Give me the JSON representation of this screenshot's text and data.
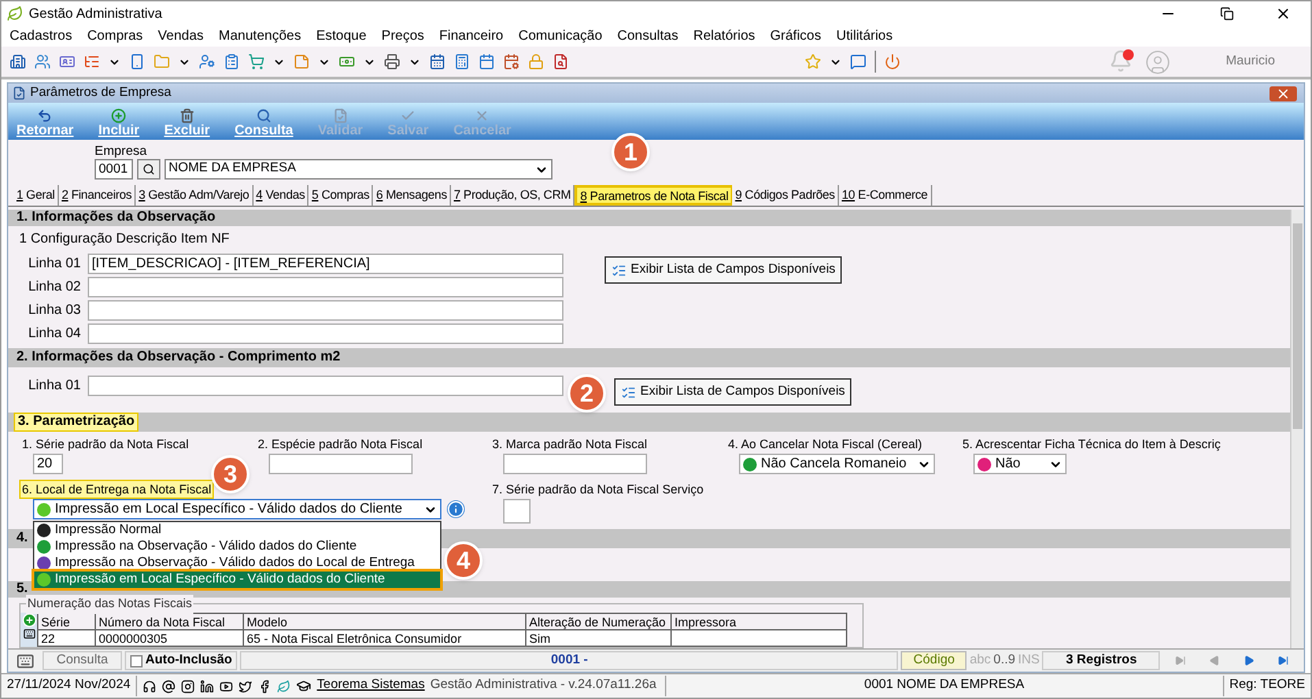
{
  "app": {
    "title": "Gestão Administrativa"
  },
  "menu": [
    "Cadastros",
    "Compras",
    "Vendas",
    "Manutenções",
    "Estoque",
    "Preços",
    "Financeiro",
    "Comunicação",
    "Consultas",
    "Relatórios",
    "Gráficos",
    "Utilitários"
  ],
  "user": {
    "name": "Mauricio"
  },
  "window": {
    "title": "Parâmetros de Empresa"
  },
  "actions": [
    {
      "kind": "back",
      "label": "Retornar",
      "disabled": false
    },
    {
      "kind": "add",
      "label": "Incluir",
      "disabled": false
    },
    {
      "kind": "delete",
      "label": "Excluir",
      "disabled": false
    },
    {
      "kind": "search",
      "label": "Consulta",
      "disabled": false
    },
    {
      "kind": "validate",
      "label": "Validar",
      "disabled": true
    },
    {
      "kind": "save",
      "label": "Salvar",
      "disabled": true
    },
    {
      "kind": "cancel",
      "label": "Cancelar",
      "disabled": true
    }
  ],
  "empresa": {
    "label": "Empresa",
    "code": "0001",
    "name": "NOME DA EMPRESA"
  },
  "tabs": [
    {
      "hotkey": "1",
      "label": " Geral",
      "selected": false
    },
    {
      "hotkey": "2",
      "label": " Financeiros",
      "selected": false
    },
    {
      "hotkey": "3",
      "label": " Gestão Adm/Varejo",
      "selected": false
    },
    {
      "hotkey": "4",
      "label": " Vendas",
      "selected": false
    },
    {
      "hotkey": "5",
      "label": " Compras",
      "selected": false
    },
    {
      "hotkey": "6",
      "label": " Mensagens",
      "selected": false
    },
    {
      "hotkey": "7",
      "label": " Produção, OS, CRM",
      "selected": false
    },
    {
      "hotkey": "8",
      "label": " Parametros de Nota Fiscal",
      "selected": true
    },
    {
      "hotkey": "9",
      "label": " Códigos Padrões",
      "selected": false
    },
    {
      "hotkey": "10",
      "label": " E-Commerce",
      "selected": false
    }
  ],
  "section1": {
    "title": "1. Informações da Observação",
    "subtitle": "1 Configuração Descrição Item NF",
    "button": "Exibir Lista de Campos Disponíveis",
    "lines": [
      {
        "label": "Linha 01",
        "value": "[ITEM_DESCRICAO] - [ITEM_REFERENCIA]"
      },
      {
        "label": "Linha 02"
      },
      {
        "label": "Linha 03"
      },
      {
        "label": "Linha 04"
      }
    ]
  },
  "section2": {
    "title": "2. Informações da Observação - Comprimento m2",
    "button": "Exibir Lista de Campos Disponíveis",
    "lines": [
      {
        "label": "Linha 01"
      }
    ]
  },
  "section3": {
    "title": "3. Parametrização",
    "highlighted": true,
    "fields": [
      {
        "kind": "input",
        "label": "1. Série padrão da Nota Fiscal",
        "value": "20",
        "highlighted": false
      },
      {
        "kind": "input",
        "label": "2. Espécie padrão Nota Fiscal",
        "highlighted": false
      },
      {
        "kind": "input",
        "label": "3. Marca padrão Nota Fiscal",
        "highlighted": false
      },
      {
        "kind": "select",
        "label": "4. Ao Cancelar Nota Fiscal (Cereal)",
        "value": "Não Cancela Romaneio",
        "color": "#1e9e3a",
        "highlighted": false
      },
      {
        "kind": "select",
        "label": "5. Acrescentar Ficha Técnica do Item à Descriç",
        "value": "Não",
        "color": "#e0207a",
        "highlighted": false
      },
      {
        "kind": "dropdown",
        "label": "6. Local de Entrega na Nota Fiscal",
        "value": "Impressão em Local Específico - Válido dados do Cliente",
        "color": "#5cc82a",
        "highlighted": true
      },
      {
        "kind": "input",
        "label": "7. Série padrão da Nota Fiscal Serviço",
        "highlighted": false
      }
    ],
    "options": [
      {
        "label": "Impressão Normal",
        "color": "#222222",
        "selected": false
      },
      {
        "label": "Impressão na Observação - Válido dados do Cliente",
        "color": "#1e9e3a",
        "selected": false
      },
      {
        "label": "Impressão na Observação - Válido dados do Local de Entrega",
        "color": "#6a3fb0",
        "selected": false
      },
      {
        "label": "Impressão em Local Específico - Válido dados do Cliente",
        "color": "#5cc82a",
        "selected": true
      }
    ]
  },
  "section4": {
    "title": "4."
  },
  "section5": {
    "title": "5."
  },
  "numbering": {
    "title": "Numeração das Notas Fiscais",
    "columns": [
      "Série",
      "Número da Nota Fiscal",
      "Modelo",
      "Alteração de Numeração",
      "Impressora"
    ],
    "rows": [
      [
        "22",
        "0000000305",
        "65 - Nota Fiscal Eletrônica Consumidor",
        "Sim"
      ]
    ]
  },
  "status": {
    "mode": "Consulta",
    "auto": {
      "label": "Auto-Inclusão",
      "checked": false
    },
    "record": "0001 -",
    "code": "Código",
    "abc": "abc",
    "digits": "0..9",
    "ins": "INS",
    "count": "3 Registros",
    "nav": [
      {
        "kind": "first",
        "disabled": true
      },
      {
        "kind": "prev",
        "disabled": true
      },
      {
        "kind": "next",
        "disabled": false
      },
      {
        "kind": "last",
        "disabled": false
      }
    ]
  },
  "app_status": {
    "date": "27/11/2024 Nov/2024",
    "link": "Teorema Sistemas",
    "version": "Gestão Administrativa - v.24.07a11.26a",
    "company": "0001 NOME DA EMPRESA",
    "reg": "Reg: TEORE"
  },
  "annotations": [
    {
      "number": "1"
    },
    {
      "number": "2"
    },
    {
      "number": "3"
    },
    {
      "number": "4"
    }
  ]
}
